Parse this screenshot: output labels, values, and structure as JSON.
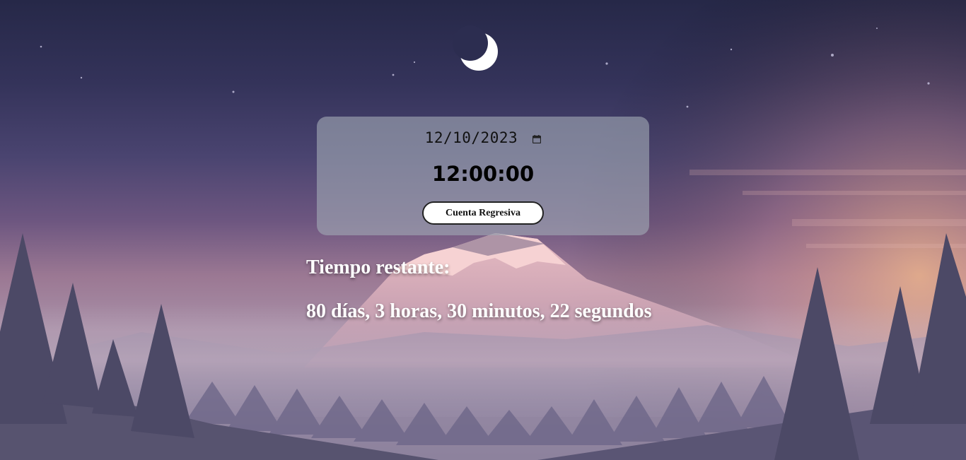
{
  "background": {
    "moon_icon": "crescent-moon-icon",
    "scene": "mountain-forest-night"
  },
  "countdown_card": {
    "date_value": "12/10/2023",
    "calendar_icon": "calendar-icon",
    "time_value": "12:00:00",
    "button_label": "Cuenta Regresiva"
  },
  "result": {
    "label": "Tiempo restante:",
    "text": "80 días, 3 horas, 30 minutos, 22 segundos"
  }
}
